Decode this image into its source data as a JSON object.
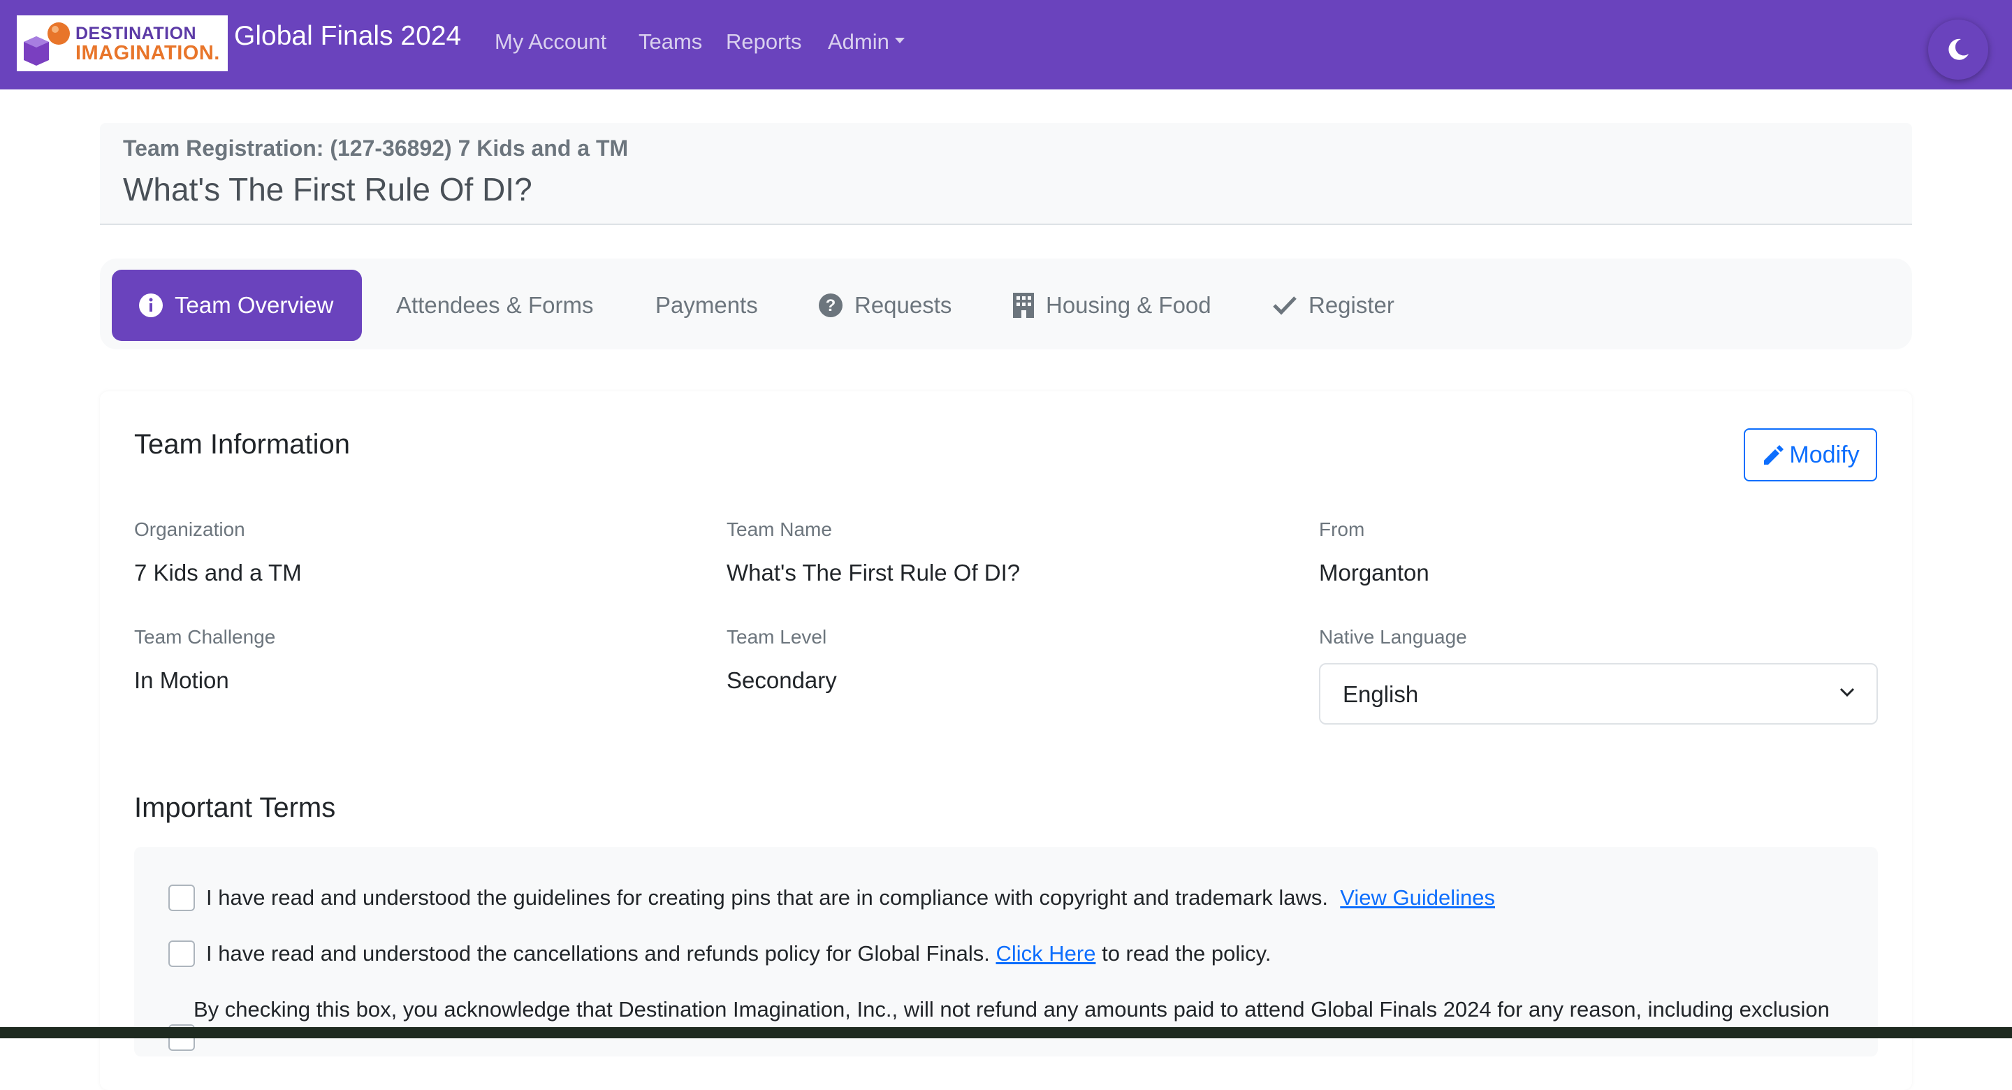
{
  "navbar": {
    "logo": {
      "line1": "DESTINATION",
      "line2": "IMAGINATION."
    },
    "title": "Global Finals 2024",
    "links": [
      "My Account",
      "Teams",
      "Reports",
      "Admin"
    ],
    "theme_icon": "moon-icon",
    "background": "#6a43bd"
  },
  "header": {
    "registration": "Team Registration: (127-36892) 7 Kids and a TM",
    "team_title": "What's The First Rule Of DI?"
  },
  "tabs": [
    {
      "label": "Team Overview",
      "icon": "info-icon",
      "active": true
    },
    {
      "label": "Attendees & Forms",
      "icon": "",
      "active": false
    },
    {
      "label": "Payments",
      "icon": "",
      "active": false
    },
    {
      "label": "Requests",
      "icon": "question-icon",
      "active": false
    },
    {
      "label": "Housing & Food",
      "icon": "building-icon",
      "active": false
    },
    {
      "label": "Register",
      "icon": "check-icon",
      "active": false
    }
  ],
  "team_info": {
    "title": "Team Information",
    "modify_label": "Modify",
    "fields": [
      {
        "label": "Organization",
        "value": "7 Kids and a TM"
      },
      {
        "label": "Team Name",
        "value": "What's The First Rule Of DI?"
      },
      {
        "label": "From",
        "value": "Morganton"
      },
      {
        "label": "Team Challenge",
        "value": "In Motion"
      },
      {
        "label": "Team Level",
        "value": "Secondary"
      },
      {
        "label": "Native Language",
        "value": "English"
      }
    ]
  },
  "terms": {
    "title": "Important Terms",
    "items": [
      {
        "text": "I have read and understood the guidelines for creating pins that are in compliance with copyright and trademark laws.",
        "link": "View Guidelines",
        "after": "",
        "checked": false
      },
      {
        "text": "I have read and understood the cancellations and refunds policy for Global Finals.",
        "link": "Click Here",
        "after": "to read the policy.",
        "checked": false
      },
      {
        "text": "By checking this box, you acknowledge that Destination Imagination, Inc., will not refund any amounts paid to attend Global Finals 2024 for any reason, including exclusion",
        "link": "",
        "after": "",
        "checked": false
      }
    ]
  },
  "colors": {
    "accent": "#6a43bd",
    "link": "#0d6efd",
    "muted": "#6c757d"
  }
}
